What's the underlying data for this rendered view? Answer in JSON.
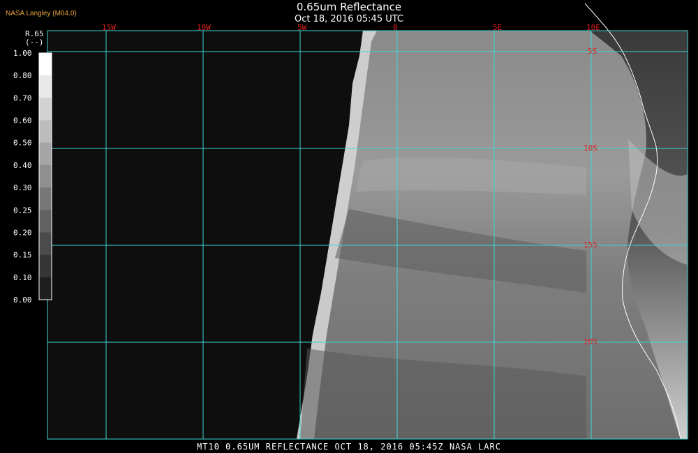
{
  "header": {
    "agency": "NASA Langley (M04.0)",
    "title": "0.65um Reflectance",
    "subtitle": "Oct 18, 2016 05:45 UTC"
  },
  "colorbar": {
    "label_line1": "R.65",
    "label_line2": "(--)",
    "ticks": [
      "1.00",
      "0.80",
      "0.70",
      "0.60",
      "0.50",
      "0.40",
      "0.30",
      "0.25",
      "0.20",
      "0.15",
      "0.10",
      "0.00"
    ]
  },
  "grid": {
    "lon_labels": [
      "15W",
      "10W",
      "5W",
      "0",
      "5E",
      "10E"
    ],
    "lat_labels": [
      "5S",
      "10S",
      "15S",
      "20S"
    ],
    "line_color": "#3fd6d6",
    "label_color": "#e02020"
  },
  "footer": {
    "text": "MT10  0.65UM REFLECTANCE   OCT 18, 2016 05:45Z   NASA LARC"
  }
}
